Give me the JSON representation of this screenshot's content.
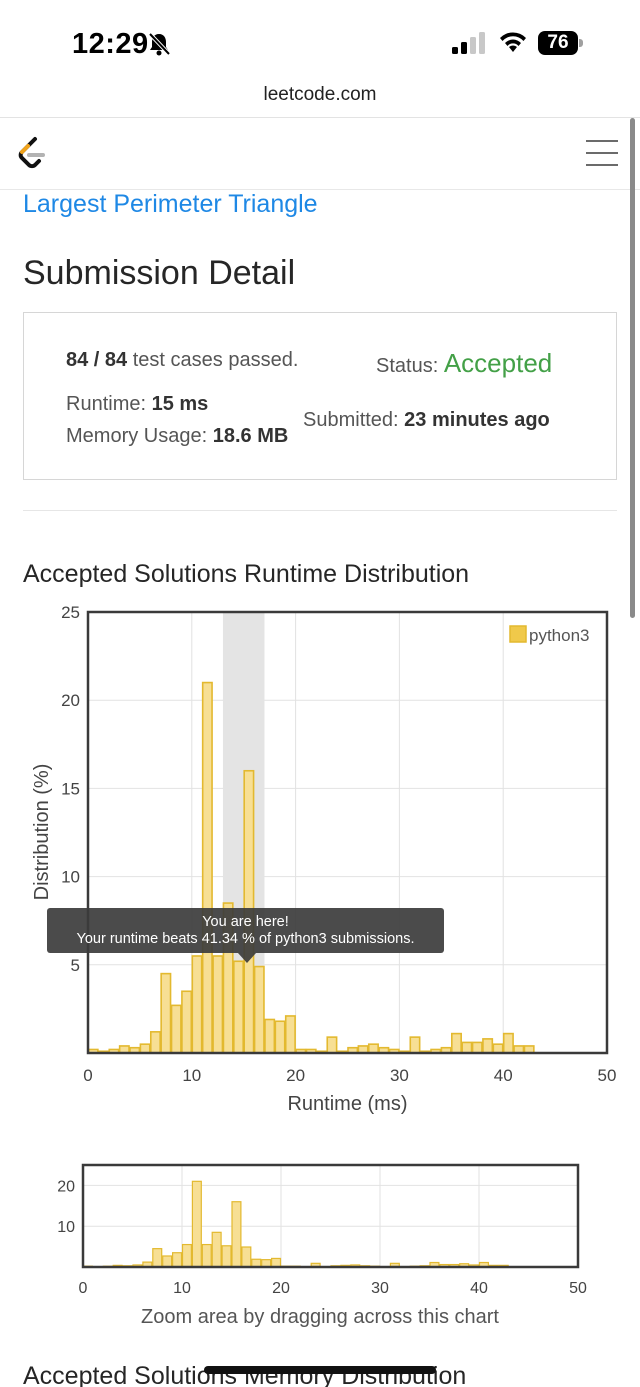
{
  "status_bar": {
    "time": "12:29",
    "battery": "76"
  },
  "url": "leetcode.com",
  "problem_title": "Largest Perimeter Triangle",
  "page_title": "Submission Detail",
  "detail": {
    "cases": "84 / 84",
    "cases_suffix": " test cases passed.",
    "status_label": "Status:",
    "status_value": "Accepted",
    "runtime_label": "Runtime:",
    "runtime_value": "15 ms",
    "memory_label": "Memory Usage:",
    "memory_value": "18.6 MB",
    "submitted_label": "Submitted:",
    "submitted_value": "23 minutes ago"
  },
  "runtime_section_title": "Accepted Solutions Runtime Distribution",
  "memory_section_title": "Accepted Solutions Memory Distribution",
  "tooltip": {
    "line1": "You are here!",
    "line2": "Your runtime beats 41.34 % of python3 submissions."
  },
  "zoom_caption": "Zoom area by dragging across this chart",
  "colors": {
    "bar_fill": "#f7df94",
    "bar_stroke": "#e3b92f",
    "accent_blue": "#1e88e5",
    "accepted_green": "#43a047",
    "highlight": "#e4e4e4"
  },
  "chart_data": [
    {
      "type": "bar",
      "name": "main-chart",
      "xlabel": "Runtime (ms)",
      "ylabel": "Distribution (%)",
      "xlim": [
        0,
        50
      ],
      "ylim": [
        0,
        25
      ],
      "x_ticks": [
        "0",
        "10",
        "20",
        "30",
        "40",
        "50"
      ],
      "y_ticks": [
        "5",
        "10",
        "15",
        "20",
        "25"
      ],
      "legend": "python3",
      "legend_position": "top-right",
      "highlight_range": [
        13,
        17
      ],
      "bin_width": 1,
      "x": [
        0,
        1,
        2,
        3,
        4,
        5,
        6,
        7,
        8,
        9,
        10,
        11,
        12,
        13,
        14,
        15,
        16,
        17,
        18,
        19,
        20,
        21,
        22,
        23,
        24,
        25,
        26,
        27,
        28,
        29,
        30,
        31,
        32,
        33,
        34,
        35,
        36,
        37,
        38,
        39,
        40,
        41,
        42
      ],
      "values": [
        0.2,
        0.1,
        0.2,
        0.4,
        0.3,
        0.5,
        1.2,
        4.5,
        2.7,
        3.5,
        5.5,
        21.0,
        5.5,
        8.5,
        5.2,
        16.0,
        4.9,
        1.9,
        1.8,
        2.1,
        0.2,
        0.2,
        0.1,
        0.9,
        0.1,
        0.3,
        0.4,
        0.5,
        0.3,
        0.2,
        0.1,
        0.9,
        0.1,
        0.2,
        0.3,
        1.1,
        0.6,
        0.6,
        0.8,
        0.5,
        1.1,
        0.4,
        0.4
      ]
    },
    {
      "type": "bar",
      "name": "zoom-chart",
      "xlim": [
        0,
        50
      ],
      "ylim": [
        0,
        25
      ],
      "x_ticks": [
        "0",
        "10",
        "20",
        "30",
        "40",
        "50"
      ],
      "y_ticks": [
        "10",
        "20"
      ]
    }
  ]
}
